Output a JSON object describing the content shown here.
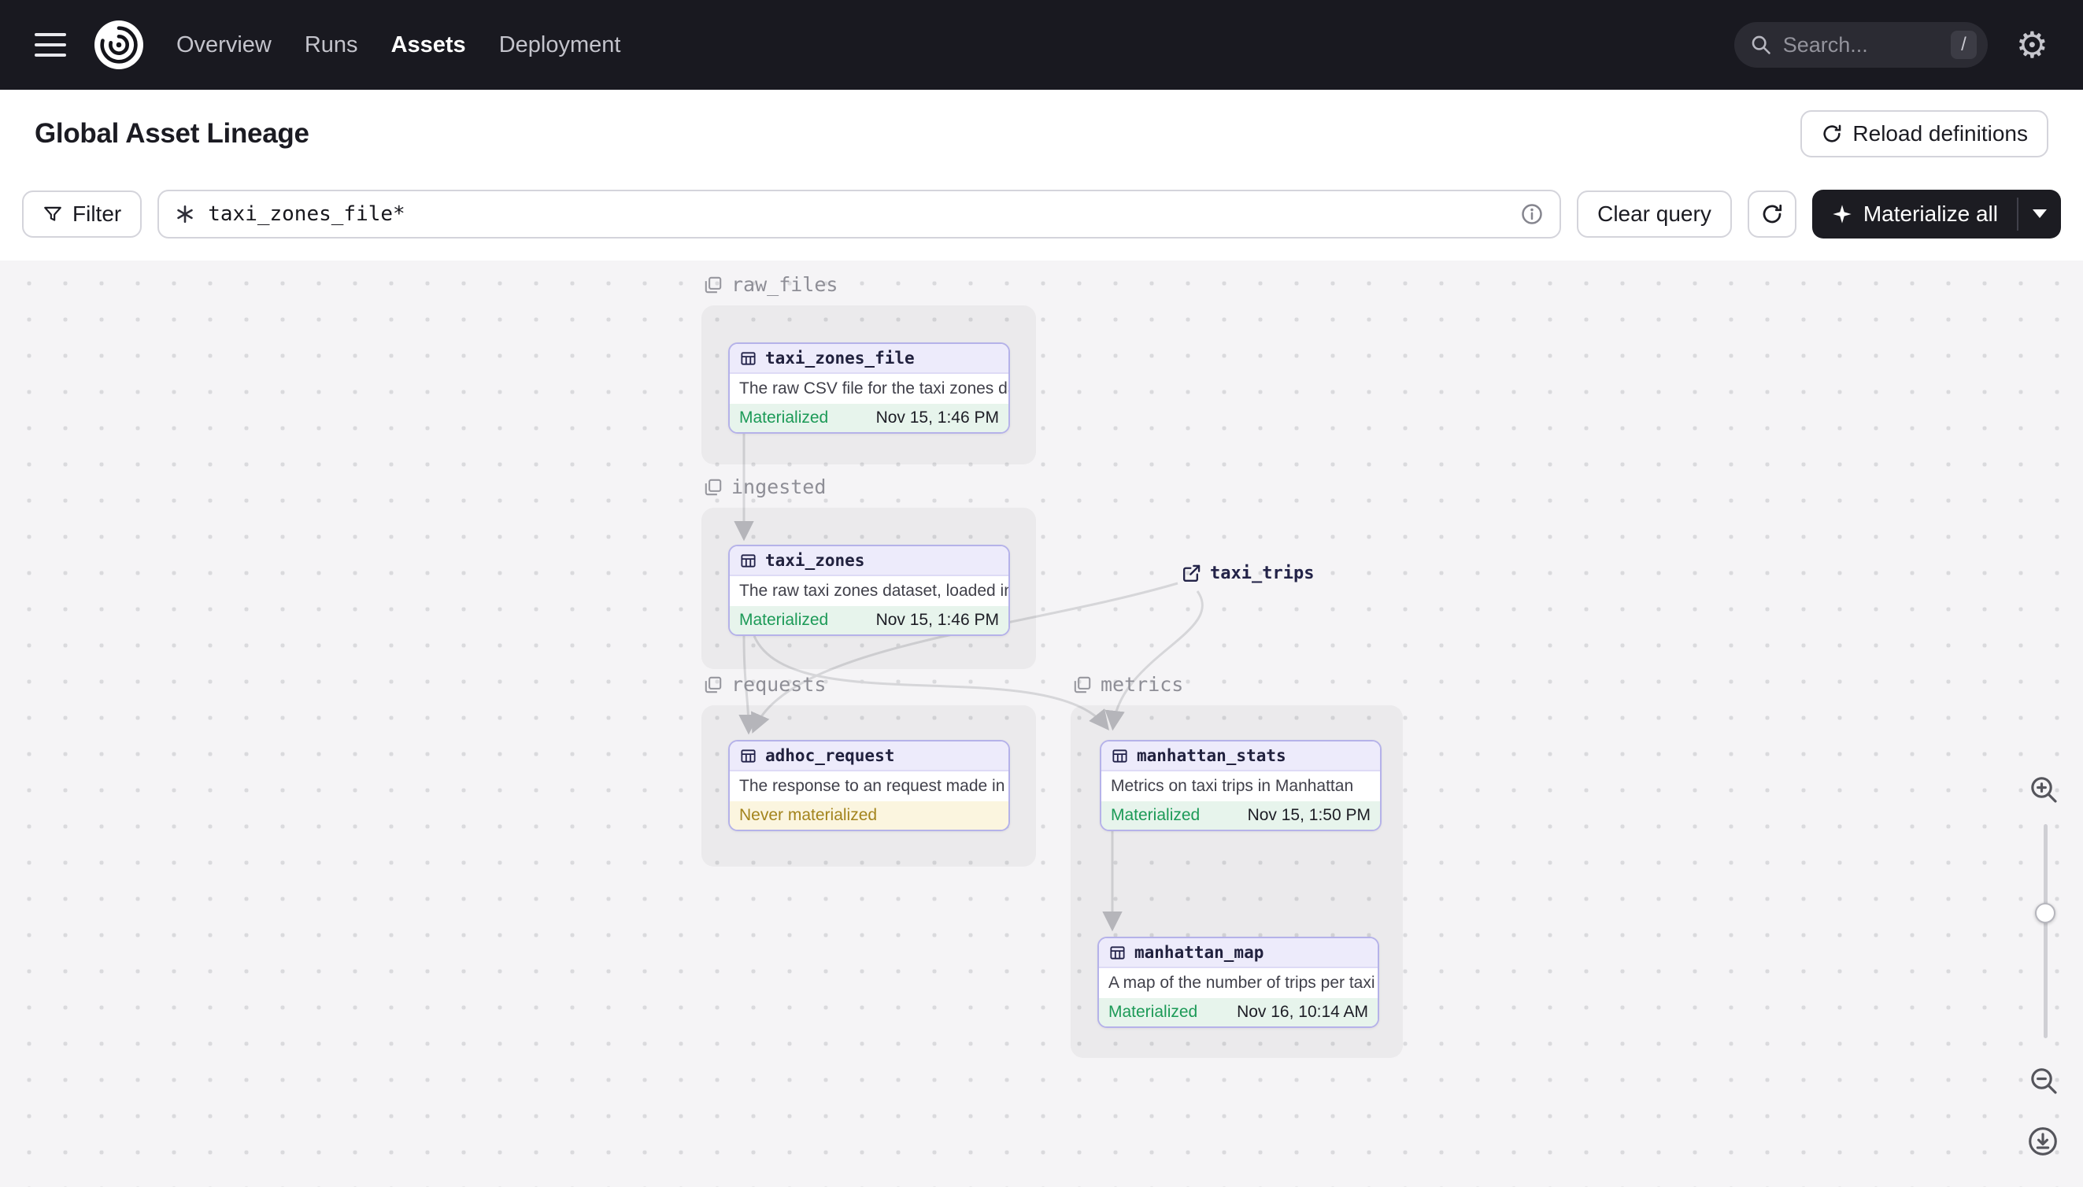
{
  "navbar": {
    "items": [
      {
        "label": "Overview",
        "active": false
      },
      {
        "label": "Runs",
        "active": false
      },
      {
        "label": "Assets",
        "active": true
      },
      {
        "label": "Deployment",
        "active": false
      }
    ],
    "search": {
      "placeholder": "Search...",
      "shortcut_key": "/"
    }
  },
  "header": {
    "title": "Global Asset Lineage",
    "reload_button_label": "Reload definitions"
  },
  "toolbar": {
    "filter_button_label": "Filter",
    "query_value": "taxi_zones_file*",
    "clear_query_label": "Clear query",
    "materialize_button_label": "Materialize all"
  },
  "graph": {
    "groups": [
      {
        "label": "raw_files"
      },
      {
        "label": "ingested"
      },
      {
        "label": "requests"
      },
      {
        "label": "metrics"
      }
    ],
    "nodes": [
      {
        "name": "taxi_zones_file",
        "description": "The raw CSV file for the taxi zones dat...",
        "status": "Materialized",
        "timestamp": "Nov 15, 1:46 PM"
      },
      {
        "name": "taxi_zones",
        "description": "The raw taxi zones dataset, loaded int...",
        "status": "Materialized",
        "timestamp": "Nov 15, 1:46 PM"
      },
      {
        "name": "adhoc_request",
        "description": "The response to an request made in th...",
        "status": "Never materialized",
        "timestamp": ""
      },
      {
        "name": "manhattan_stats",
        "description": "Metrics on taxi trips in Manhattan",
        "status": "Materialized",
        "timestamp": "Nov 15, 1:50 PM"
      },
      {
        "name": "manhattan_map",
        "description": "A map of the number of trips per taxi z...",
        "status": "Materialized",
        "timestamp": "Nov 16, 10:14 AM"
      }
    ],
    "external_assets": [
      {
        "name": "taxi_trips"
      }
    ]
  },
  "colors": {
    "nav_bg": "#191920",
    "canvas_bg": "#f5f4f6",
    "node_border_purple": "#b5b2e9",
    "node_header_purple": "#edebfb",
    "materialized_green": "#1c9a57",
    "materialized_bg": "#e7f4ec",
    "never_materialized_yellow": "#a3841d",
    "never_materialized_bg": "#fbf5df",
    "materialize_button_bg": "#1c1c22"
  }
}
